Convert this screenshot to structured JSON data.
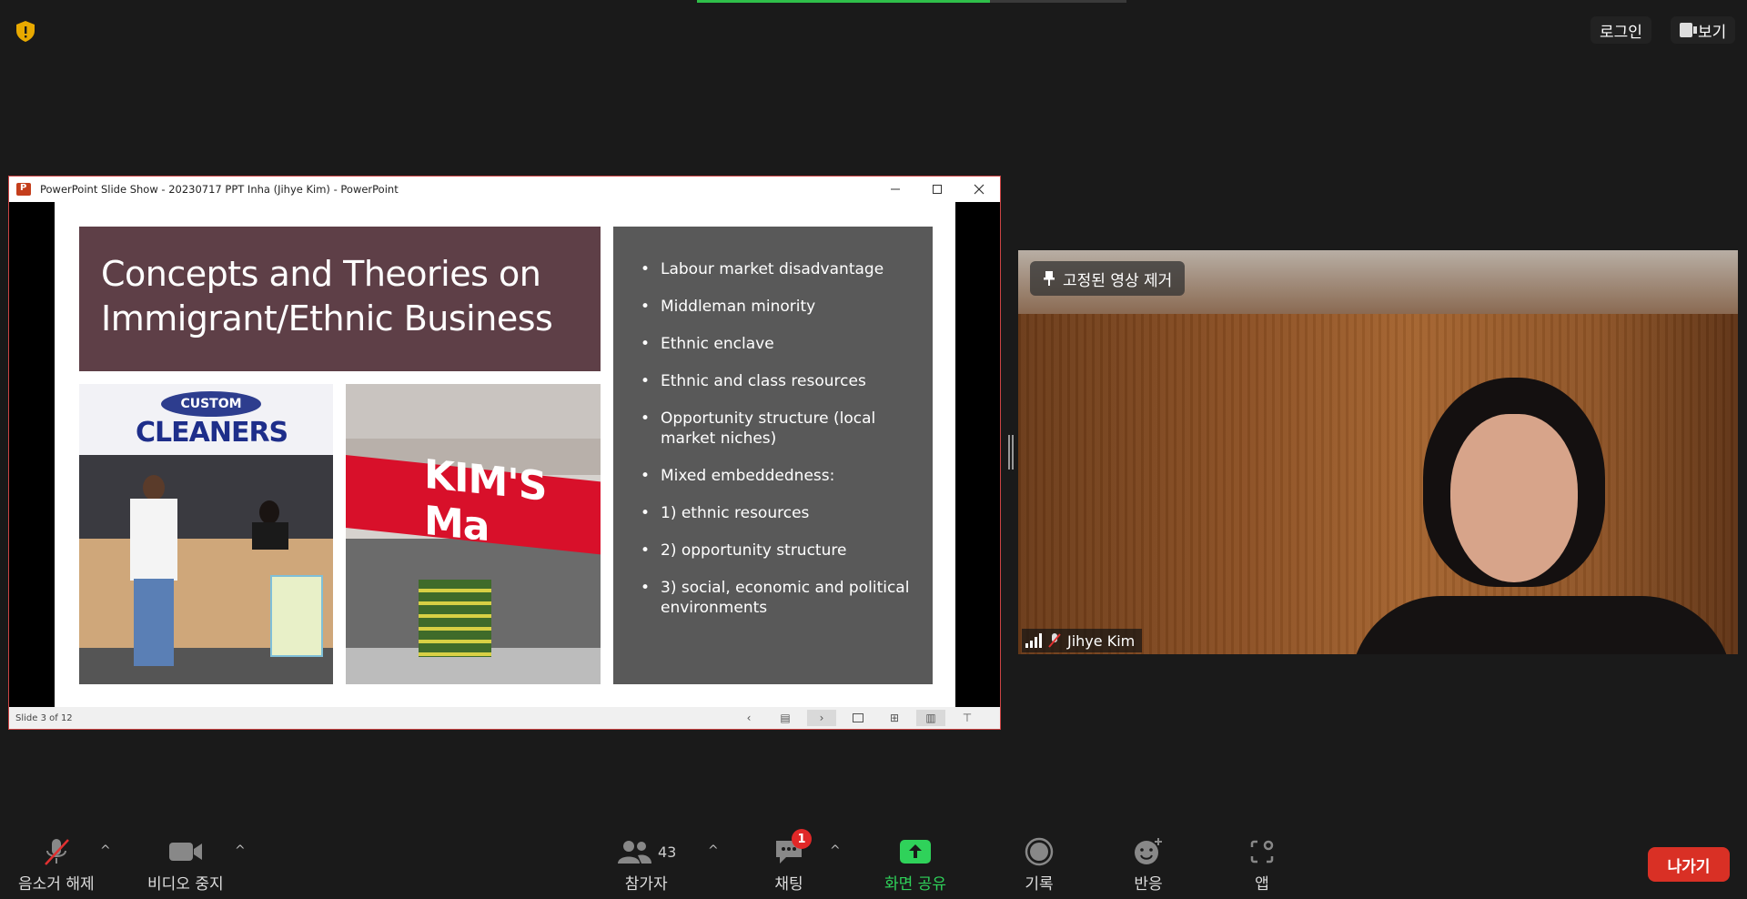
{
  "header": {
    "login_label": "로그인",
    "view_label": "보기"
  },
  "ppt": {
    "window_title": "PowerPoint Slide Show  -  20230717 PPT Inha (Jihye Kim) - PowerPoint",
    "slide_title": "Concepts and Theories on\nImmigrant/Ethnic Business",
    "photo1_oval_text": "CUSTOM",
    "photo1_brand_text": "CLEANERS",
    "photo2_store_text": "KIM'S Ma",
    "bullets": [
      "Labour market disadvantage",
      "Middleman minority",
      "Ethnic enclave",
      "Ethnic and class resources",
      "Opportunity structure (local market niches)",
      "Mixed embeddedness:",
      "1) ethnic resources",
      "2) opportunity structure",
      "3) social, economic and political environments"
    ],
    "slide_counter": "Slide 3 of 12"
  },
  "video": {
    "pin_label": "고정된 영상 제거",
    "participant_name": "Jihye Kim"
  },
  "toolbar": {
    "unmute_label": "음소거 해제",
    "stop_video_label": "비디오 중지",
    "participants_label": "참가자",
    "participants_count": "43",
    "chat_label": "채팅",
    "chat_badge": "1",
    "share_label": "화면 공유",
    "record_label": "기록",
    "reactions_label": "반응",
    "apps_label": "앱",
    "leave_label": "나가기"
  },
  "colors": {
    "share_green": "#2fd25a",
    "leave_red": "#d93025",
    "slide_title_bg": "#5e3f47",
    "bullet_bg": "#595959"
  }
}
